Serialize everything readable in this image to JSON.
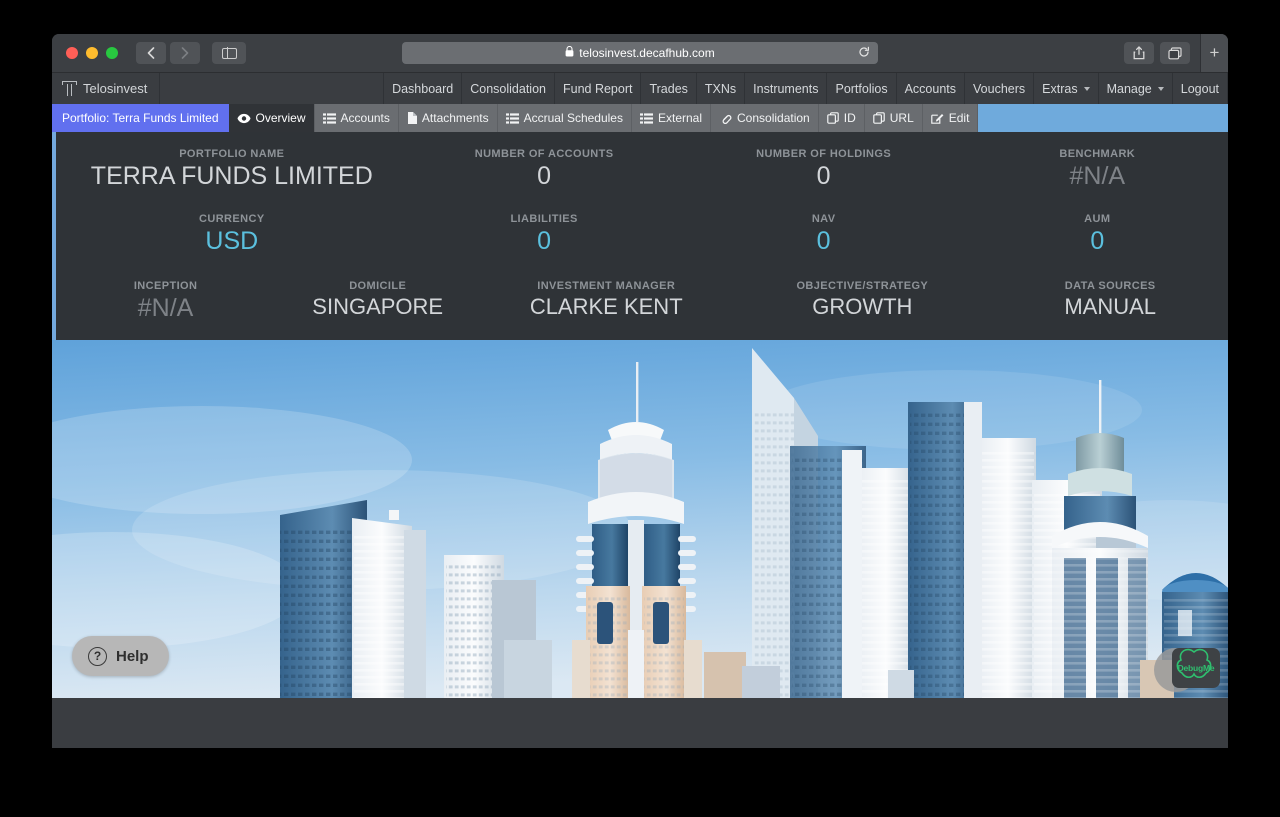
{
  "browser": {
    "url": "telosinvest.decafhub.com",
    "lock_icon": "lock-icon",
    "reload_icon": "reload-icon",
    "back_icon": "back-chevron-icon",
    "forward_icon": "forward-chevron-icon",
    "sidebar_icon": "sidebar-toggle-icon",
    "share_icon": "share-icon",
    "tabs_icon": "tabs-overview-icon",
    "newtab_icon": "+"
  },
  "appnav": {
    "brand": "Telosinvest",
    "links": [
      {
        "label": "Dashboard",
        "caret": false
      },
      {
        "label": "Consolidation",
        "caret": false
      },
      {
        "label": "Fund Report",
        "caret": false
      },
      {
        "label": "Trades",
        "caret": false
      },
      {
        "label": "TXNs",
        "caret": false
      },
      {
        "label": "Instruments",
        "caret": false
      },
      {
        "label": "Portfolios",
        "caret": false
      },
      {
        "label": "Accounts",
        "caret": false
      },
      {
        "label": "Vouchers",
        "caret": false
      },
      {
        "label": "Extras",
        "caret": true
      },
      {
        "label": "Manage",
        "caret": true
      },
      {
        "label": "Logout",
        "caret": false
      }
    ]
  },
  "tabstrip": {
    "portfolio_chip": "Portfolio: Terra Funds Limited",
    "tabs": [
      {
        "label": "Overview",
        "icon": "eye-icon",
        "active": true
      },
      {
        "label": "Accounts",
        "icon": "list-icon",
        "active": false
      },
      {
        "label": "Attachments",
        "icon": "file-icon",
        "active": false
      },
      {
        "label": "Accrual Schedules",
        "icon": "list-icon",
        "active": false
      },
      {
        "label": "External",
        "icon": "list-icon",
        "active": false
      },
      {
        "label": "Consolidation",
        "icon": "link-icon",
        "active": false
      },
      {
        "label": "ID",
        "icon": "copy-icon",
        "active": false
      },
      {
        "label": "URL",
        "icon": "copy-icon",
        "active": false
      },
      {
        "label": "Edit",
        "icon": "pencil-icon",
        "active": false
      }
    ]
  },
  "panel": {
    "row1": [
      {
        "label": "Portfolio Name",
        "value": "TERRA FUNDS LIMITED",
        "style": "big"
      },
      {
        "label": "Number of Accounts",
        "value": "0",
        "style": "mid"
      },
      {
        "label": "Number of Holdings",
        "value": "0",
        "style": "mid"
      },
      {
        "label": "Benchmark",
        "value": "#N/A",
        "style": "dim"
      }
    ],
    "row2": [
      {
        "label": "Currency",
        "value": "USD",
        "style": "blue"
      },
      {
        "label": "Liabilities",
        "value": "0",
        "style": "blue"
      },
      {
        "label": "NAV",
        "value": "0",
        "style": "blue"
      },
      {
        "label": "AUM",
        "value": "0",
        "style": "blue"
      }
    ],
    "row3": [
      {
        "label": "Inception",
        "value": "#N/A",
        "style": "dim"
      },
      {
        "label": "Domicile",
        "value": "SINGAPORE",
        "style": "med"
      },
      {
        "label": "Investment Manager",
        "value": "CLARKE KENT",
        "style": "med"
      },
      {
        "label": "Objective/Strategy",
        "value": "GROWTH",
        "style": "med"
      },
      {
        "label": "Data Sources",
        "value": "MANUAL",
        "style": "med"
      }
    ]
  },
  "photo": {
    "alt": "city-skyline-photo",
    "help_label": "Help",
    "help_icon": "question-circle-icon",
    "debug_label": "DebugMe"
  },
  "colors": {
    "accent_blue": "#6faadc",
    "chip_purple": "#6170ef",
    "value_cyan": "#5bc0de",
    "panel_bg": "#2f3337",
    "debug_green": "#2fbf6f"
  }
}
